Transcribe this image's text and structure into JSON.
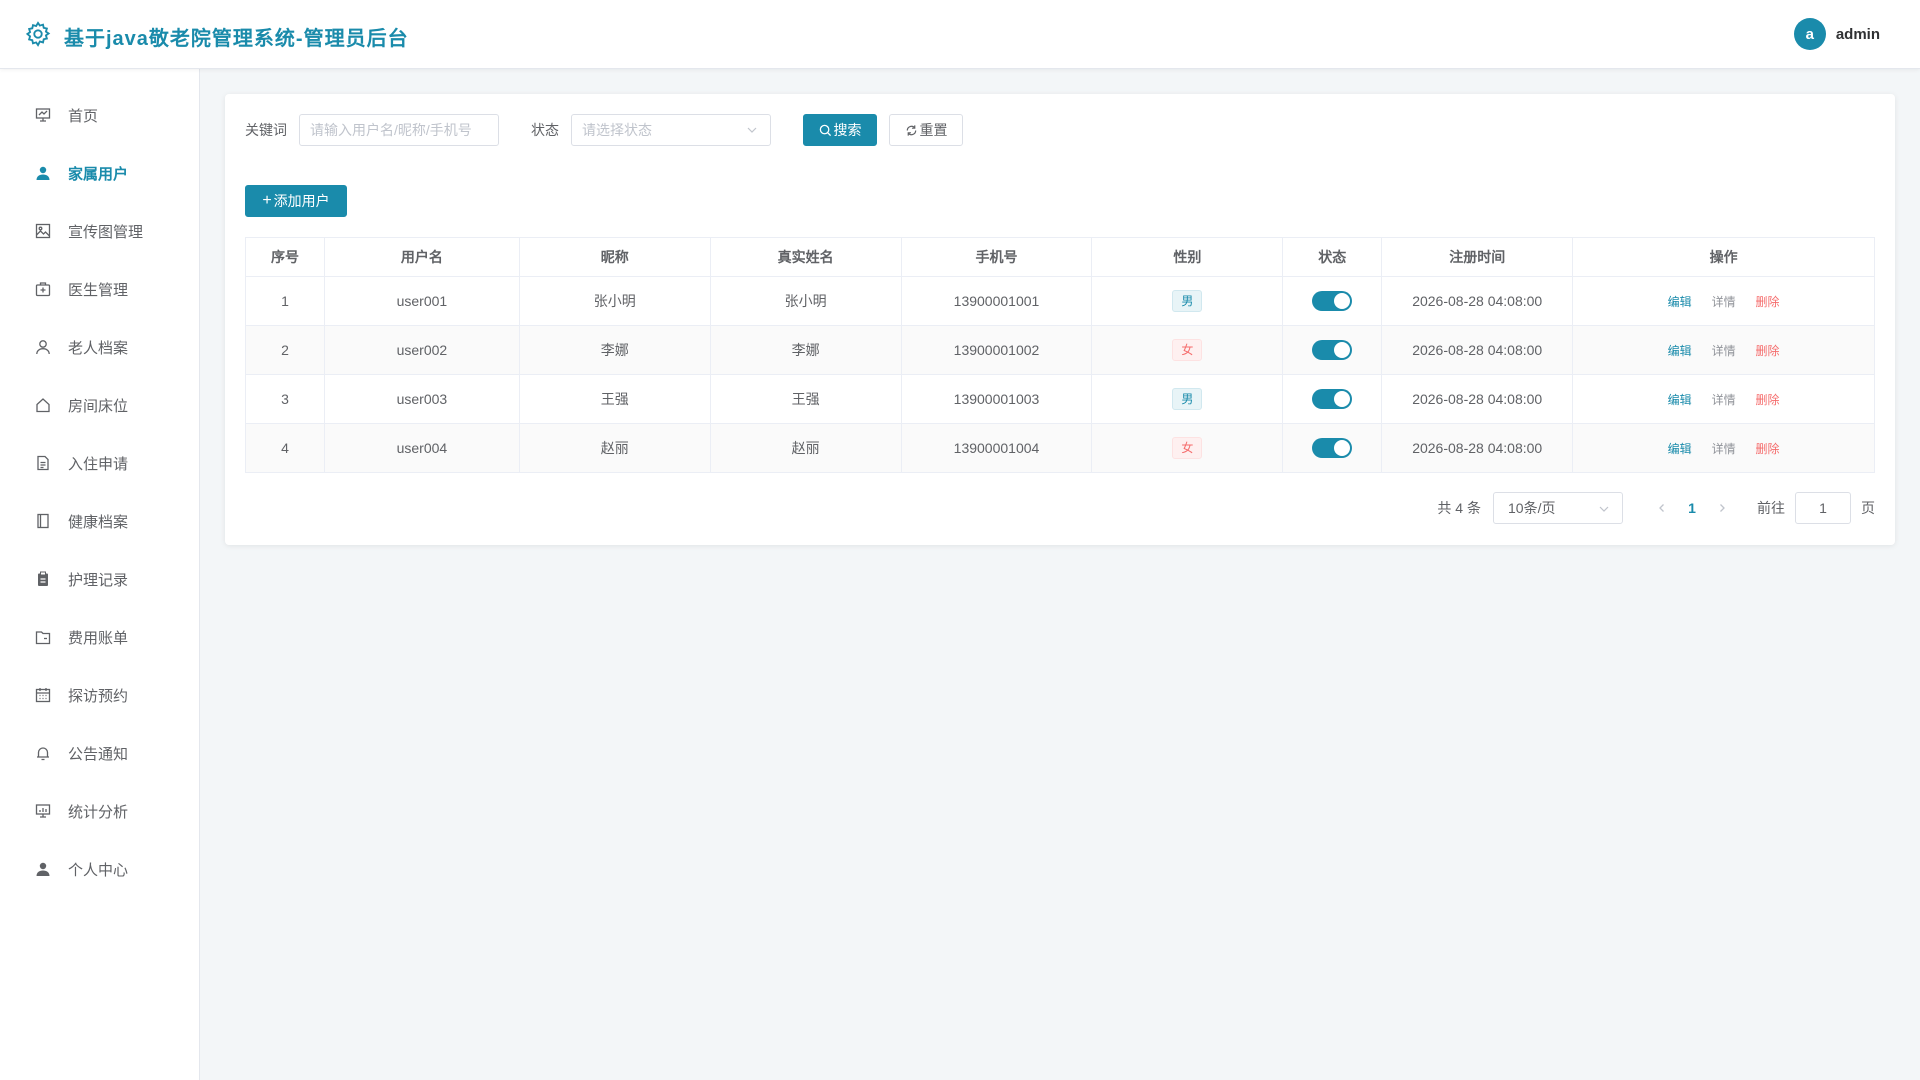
{
  "header": {
    "title": "基于java敬老院管理系统-管理员后台",
    "avatar_letter": "a",
    "username": "admin"
  },
  "sidebar": {
    "items": [
      {
        "label": "首页",
        "icon": "presentation-board-icon",
        "active": false
      },
      {
        "label": "家属用户",
        "icon": "user-icon",
        "active": true
      },
      {
        "label": "宣传图管理",
        "icon": "image-icon",
        "active": false
      },
      {
        "label": "医生管理",
        "icon": "first-aid-kit-icon",
        "active": false
      },
      {
        "label": "老人档案",
        "icon": "user-outline-icon",
        "active": false
      },
      {
        "label": "房间床位",
        "icon": "house-icon",
        "active": false
      },
      {
        "label": "入住申请",
        "icon": "document-icon",
        "active": false
      },
      {
        "label": "健康档案",
        "icon": "notebook-icon",
        "active": false
      },
      {
        "label": "护理记录",
        "icon": "clipboard-icon",
        "active": false
      },
      {
        "label": "费用账单",
        "icon": "folder-icon",
        "active": false
      },
      {
        "label": "探访预约",
        "icon": "calendar-icon",
        "active": false
      },
      {
        "label": "公告通知",
        "icon": "bell-icon",
        "active": false
      },
      {
        "label": "统计分析",
        "icon": "chart-board-icon",
        "active": false
      },
      {
        "label": "个人中心",
        "icon": "user-icon",
        "active": false
      }
    ]
  },
  "filter": {
    "keyword_label": "关键词",
    "keyword_placeholder": "请输入用户名/昵称/手机号",
    "status_label": "状态",
    "status_placeholder": "请选择状态",
    "search_label": "搜索",
    "reset_label": "重置"
  },
  "add_button_label": "添加用户",
  "table": {
    "columns": [
      "序号",
      "用户名",
      "昵称",
      "真实姓名",
      "手机号",
      "性别",
      "状态",
      "注册时间",
      "操作"
    ],
    "actions": {
      "edit": "编辑",
      "detail": "详情",
      "delete": "删除"
    },
    "rows": [
      {
        "index": "1",
        "username": "user001",
        "nickname": "张小明",
        "realname": "张小明",
        "phone": "13900001001",
        "gender": "男",
        "status_on": true,
        "created": "2026-08-28 04:08:00"
      },
      {
        "index": "2",
        "username": "user002",
        "nickname": "李娜",
        "realname": "李娜",
        "phone": "13900001002",
        "gender": "女",
        "status_on": true,
        "created": "2026-08-28 04:08:00"
      },
      {
        "index": "3",
        "username": "user003",
        "nickname": "王强",
        "realname": "王强",
        "phone": "13900001003",
        "gender": "男",
        "status_on": true,
        "created": "2026-08-28 04:08:00"
      },
      {
        "index": "4",
        "username": "user004",
        "nickname": "赵丽",
        "realname": "赵丽",
        "phone": "13900001004",
        "gender": "女",
        "status_on": true,
        "created": "2026-08-28 04:08:00"
      }
    ]
  },
  "pagination": {
    "total_text": "共 4 条",
    "page_size": "10条/页",
    "current_page": "1",
    "goto_label": "前往",
    "goto_value": "1",
    "page_suffix": "页"
  },
  "colors": {
    "accent": "#1a8bab",
    "danger": "#f56c6c"
  }
}
